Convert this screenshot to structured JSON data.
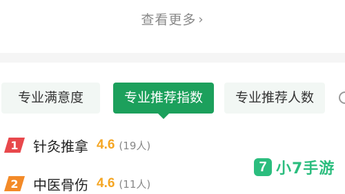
{
  "view_more": {
    "label": "查看更多",
    "chevron": "›"
  },
  "tabs": [
    {
      "label": "专业满意度",
      "active": false
    },
    {
      "label": "专业推荐指数",
      "active": true
    },
    {
      "label": "专业推荐人数",
      "active": false
    }
  ],
  "ranking": [
    {
      "rank": "1",
      "name": "针灸推拿",
      "score": "4.6",
      "count": "(19人)",
      "badge_color": "#e8484c"
    },
    {
      "rank": "2",
      "name": "中医骨伤",
      "score": "4.6",
      "count": "(11人)",
      "badge_color": "#f38a28"
    }
  ],
  "watermark": {
    "logo": "7",
    "text": "小7手游"
  },
  "colors": {
    "accent_green": "#1ca05c",
    "score_orange": "#f5a623",
    "tab_bg": "#f2f7f4",
    "watermark_green": "#2bbd7e"
  }
}
